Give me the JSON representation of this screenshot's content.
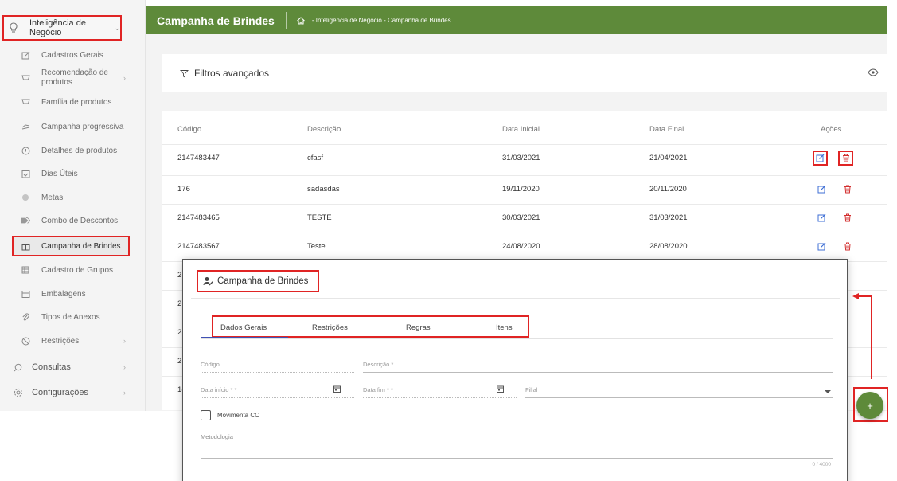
{
  "sidebar": {
    "top_item": "Inteligência de Negócio",
    "items": [
      {
        "label": "Cadastros Gerais",
        "icon": "edit-icon"
      },
      {
        "label": "Recomendação de produtos",
        "line1": "Recomendação de",
        "line2": "produtos",
        "icon": "basket-icon"
      },
      {
        "label": "Família de produtos",
        "icon": "basket-icon"
      },
      {
        "label": "Campanha progressiva",
        "icon": "trend-icon"
      },
      {
        "label": "Detalhes de produtos",
        "icon": "info-icon"
      },
      {
        "label": "Dias Úteis",
        "icon": "calendar-check-icon"
      },
      {
        "label": "Metas",
        "icon": "dot-icon"
      },
      {
        "label": "Combo de Descontos",
        "icon": "tags-icon"
      },
      {
        "label": "Campanha de Brindes",
        "icon": "gift-icon"
      },
      {
        "label": "Cadastro de Grupos",
        "icon": "grid-icon"
      },
      {
        "label": "Embalagens",
        "icon": "box-icon"
      },
      {
        "label": "Tipos de Anexos",
        "icon": "attachment-icon"
      },
      {
        "label": "Restrições",
        "icon": "block-icon"
      }
    ],
    "roots": [
      {
        "label": "Consultas",
        "icon": "search-icon"
      },
      {
        "label": "Configurações",
        "icon": "gear-icon"
      }
    ]
  },
  "header": {
    "title": "Campanha de Brindes",
    "breadcrumb": "- Inteligência de Negócio - Campanha de Brindes"
  },
  "filters": {
    "label": "Filtros avançados"
  },
  "table": {
    "columns": [
      "Código",
      "Descrição",
      "Data Inicial",
      "Data Final",
      "Ações"
    ],
    "rows": [
      {
        "codigo": "2147483447",
        "descricao": "cfasf",
        "inicio": "31/03/2021",
        "fim": "21/04/2021"
      },
      {
        "codigo": "176",
        "descricao": "sadasdas",
        "inicio": "19/11/2020",
        "fim": "20/11/2020"
      },
      {
        "codigo": "2147483465",
        "descricao": "TESTE",
        "inicio": "30/03/2021",
        "fim": "31/03/2021"
      },
      {
        "codigo": "2147483567",
        "descricao": "Teste",
        "inicio": "24/08/2020",
        "fim": "28/08/2020"
      }
    ],
    "partial_rows": [
      "2",
      "2",
      "2",
      "2",
      "1("
    ]
  },
  "modal": {
    "title": "Campanha de Brindes",
    "tabs": [
      "Dados Gerais",
      "Restrições",
      "Regras",
      "Itens"
    ],
    "fields": {
      "codigo": "Código",
      "descricao": "Descrição *",
      "data_inicio": "Data início * *",
      "data_fim": "Data fim * *",
      "filial": "Filial",
      "movimenta": "Movimenta CC",
      "metodologia": "Metodologia",
      "counter": "0 / 4000"
    }
  },
  "fab": {
    "label": "+"
  },
  "colors": {
    "header_green": "#5e8a3a",
    "annotation_red": "#e02424",
    "edit_blue": "#3f6fd6",
    "delete_red": "#d32f2f"
  }
}
